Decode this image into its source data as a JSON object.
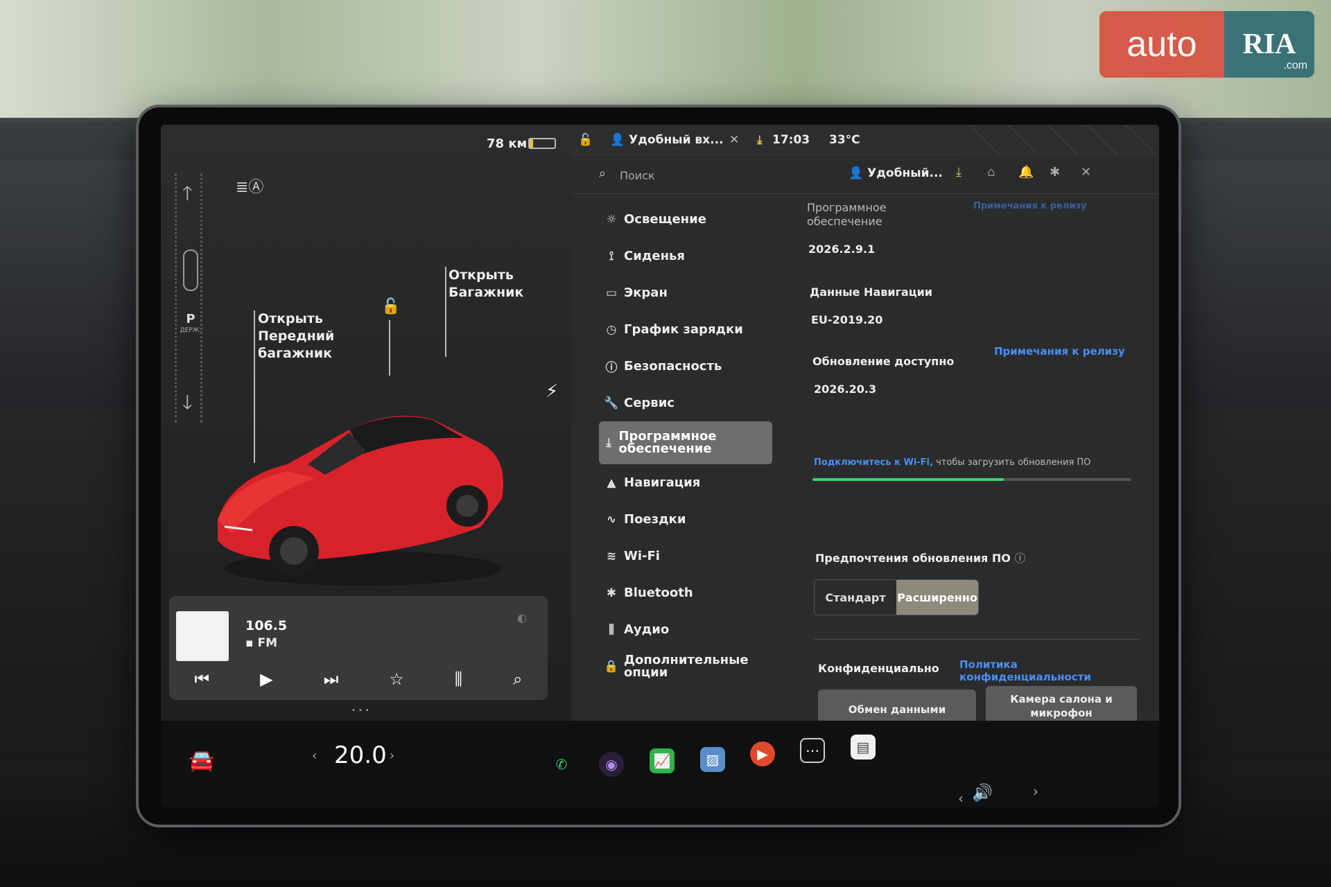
{
  "logo": {
    "left": "auto",
    "right": "RIA",
    "suffix": ".com"
  },
  "vehicle": {
    "range": "78 км",
    "battery_level": 0.15,
    "gear": "P",
    "gear_hold": "ДЕРЖ.",
    "front_trunk_callout": [
      "Открыть",
      "Передний",
      "багажник"
    ],
    "trunk_callout": [
      "Открыть",
      "Багажник"
    ]
  },
  "media": {
    "frequency": "106.5",
    "band": "FM",
    "controls": [
      "previous",
      "play",
      "next",
      "favorite",
      "equalizer",
      "search"
    ]
  },
  "climate": {
    "temperature": "20.0",
    "left_arrow": "‹",
    "right_arrow": "›"
  },
  "status_bar": {
    "profile": "Удобный вх...",
    "time": "17:03",
    "temperature": "33°C"
  },
  "search": {
    "placeholder": "Поиск"
  },
  "profile_button": "Удобный...",
  "menu": [
    {
      "label": "Освещение",
      "icon": "sun-icon"
    },
    {
      "label": "Сиденья",
      "icon": "seat-icon"
    },
    {
      "label": "Экран",
      "icon": "display-icon"
    },
    {
      "label": "График зарядки",
      "icon": "charge-schedule-icon"
    },
    {
      "label": "Безопасность",
      "icon": "shield-icon"
    },
    {
      "label": "Сервис",
      "icon": "wrench-icon"
    },
    {
      "label": "Программное обеспечение",
      "icon": "download-icon",
      "active": true
    },
    {
      "label": "Навигация",
      "icon": "navigation-icon"
    },
    {
      "label": "Поездки",
      "icon": "trips-icon"
    },
    {
      "label": "Wi-Fi",
      "icon": "wifi-icon"
    },
    {
      "label": "Bluetooth",
      "icon": "bluetooth-icon"
    },
    {
      "label": "Аудио",
      "icon": "equalizer-icon"
    },
    {
      "label": "Дополнительные опции",
      "icon": "bag-icon"
    }
  ],
  "software": {
    "software_label": "Программное обеспечение",
    "software_version": "2026.2.9.1",
    "release_notes_top": "Примечания к релизу",
    "nav_data_label": "Данные Навигации",
    "nav_data_version": "EU-2019.20",
    "update_label": "Обновление доступно",
    "update_version": "2026.20.3",
    "release_notes": "Примечания к релизу",
    "wifi_link": "Подключитесь к Wi-Fi,",
    "wifi_text": "чтобы загрузить обновления ПО",
    "download_progress": 0.6,
    "prefs_label": "Предпочтения обновления ПО",
    "pref_standard": "Стандарт",
    "pref_advanced": "Расширенно",
    "privacy_label": "Конфиденциально",
    "privacy_link": "Политика конфиденциальности",
    "data_sharing": "Обмен данными",
    "cabin_camera": "Камера салона и микрофон"
  },
  "colors": {
    "accent_link": "#4a8ff2",
    "progress": "#3cd46a",
    "car_body": "#d8222a",
    "selected_segment": "#8c8a7c"
  }
}
